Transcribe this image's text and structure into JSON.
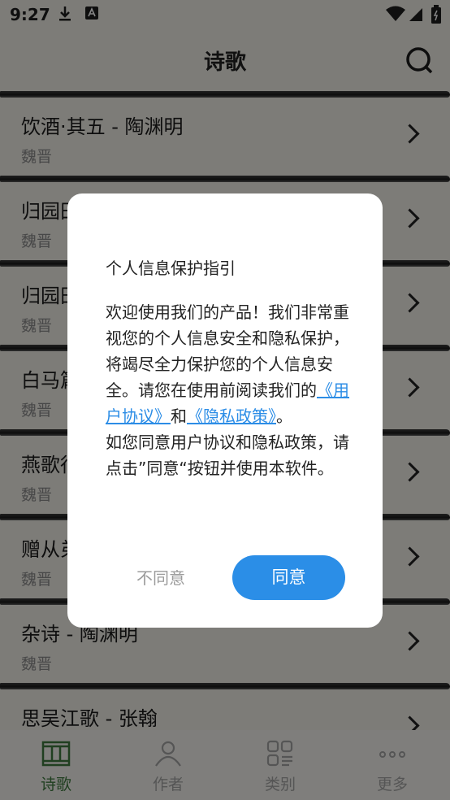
{
  "status_bar": {
    "time": "9:27"
  },
  "header": {
    "title": "诗歌"
  },
  "poems": [
    {
      "title": "饮酒·其五 - 陶渊明",
      "dynasty": "魏晋"
    },
    {
      "title": "归园田居·其一 - 陶渊明",
      "dynasty": "魏晋"
    },
    {
      "title": "归园田居·其三 - 陶渊明",
      "dynasty": "魏晋"
    },
    {
      "title": "白马篇 - 曹植",
      "dynasty": "魏晋"
    },
    {
      "title": "燕歌行 - 曹丕",
      "dynasty": "魏晋"
    },
    {
      "title": "赠从弟 - 刘桢",
      "dynasty": "魏晋"
    },
    {
      "title": "杂诗 - 陶渊明",
      "dynasty": "魏晋"
    },
    {
      "title": "思吴江歌 - 张翰",
      "dynasty": ""
    }
  ],
  "tabs": [
    {
      "label": "诗歌",
      "icon": "poem-icon",
      "active": true
    },
    {
      "label": "作者",
      "icon": "person-icon",
      "active": false
    },
    {
      "label": "类别",
      "icon": "category-icon",
      "active": false
    },
    {
      "label": "更多",
      "icon": "more-icon",
      "active": false
    }
  ],
  "dialog": {
    "title": "个人信息保护指引",
    "para1_text": " 欢迎使用我们的产品！我们非常重视您的个人信息安全和隐私保护，将竭尽全力保护您的个人信息安全。请您在使用前阅读我们的",
    "link_user": "《用户协议》",
    "and": "和",
    "link_privacy": "《隐私政策》",
    "period": "。",
    "para2": " 如您同意用户协议和隐私政策，请点击”同意“按钮并使用本软件。",
    "disagree": "不同意",
    "agree": "同意"
  },
  "colors": {
    "accent": "#2b8ee7",
    "active_tab": "#3e7a3e",
    "overlay": "rgba(0,0,0,0.48)"
  }
}
